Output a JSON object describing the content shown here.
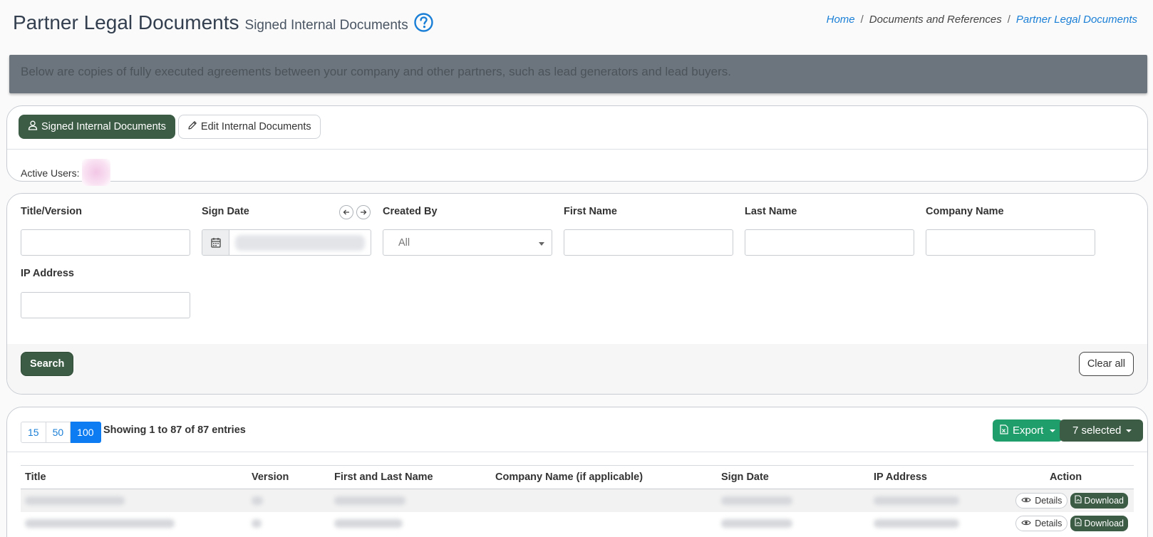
{
  "header": {
    "title": "Partner Legal Documents",
    "subtitle": "Signed Internal Documents",
    "help_icon": "question-circle-icon"
  },
  "breadcrumb": [
    {
      "label": "Home",
      "link": true
    },
    {
      "label": "Documents and References",
      "link": false
    },
    {
      "label": "Partner Legal Documents",
      "link": true
    }
  ],
  "info_banner": "Below are copies of fully executed agreements between your company and other partners, such as lead generators and lead buyers.",
  "tabs": [
    {
      "label": "Signed Internal Documents",
      "icon": "user-icon",
      "active": true
    },
    {
      "label": "Edit Internal Documents",
      "icon": "pencil-icon",
      "active": false
    }
  ],
  "active_users_label": "Active Users:",
  "filters": {
    "title_version": {
      "label": "Title/Version",
      "value": ""
    },
    "sign_date": {
      "label": "Sign Date",
      "value": ""
    },
    "created_by": {
      "label": "Created By",
      "selected": "All"
    },
    "first_name": {
      "label": "First Name",
      "value": ""
    },
    "last_name": {
      "label": "Last Name",
      "value": ""
    },
    "company_name": {
      "label": "Company Name",
      "value": ""
    },
    "ip_address": {
      "label": "IP Address",
      "value": ""
    }
  },
  "buttons": {
    "search": "Search",
    "clear_all": "Clear all",
    "export": "Export",
    "selected": "7 selected"
  },
  "pager": {
    "options": [
      "15",
      "50",
      "100"
    ],
    "active": "100"
  },
  "entries_info": "Showing 1 to 87 of 87 entries",
  "table": {
    "columns": [
      "Title",
      "Version",
      "First and Last Name",
      "Company Name (if applicable)",
      "Sign Date",
      "IP Address",
      "Action"
    ],
    "row_actions": {
      "details": "Details",
      "download": "Download"
    }
  },
  "colors": {
    "primary_green": "#3c5c45",
    "export_green": "#1f9d6a",
    "link_blue": "#1a7fd6",
    "banner_gray": "#6c757d",
    "page_active_blue": "#0d7cf2"
  }
}
